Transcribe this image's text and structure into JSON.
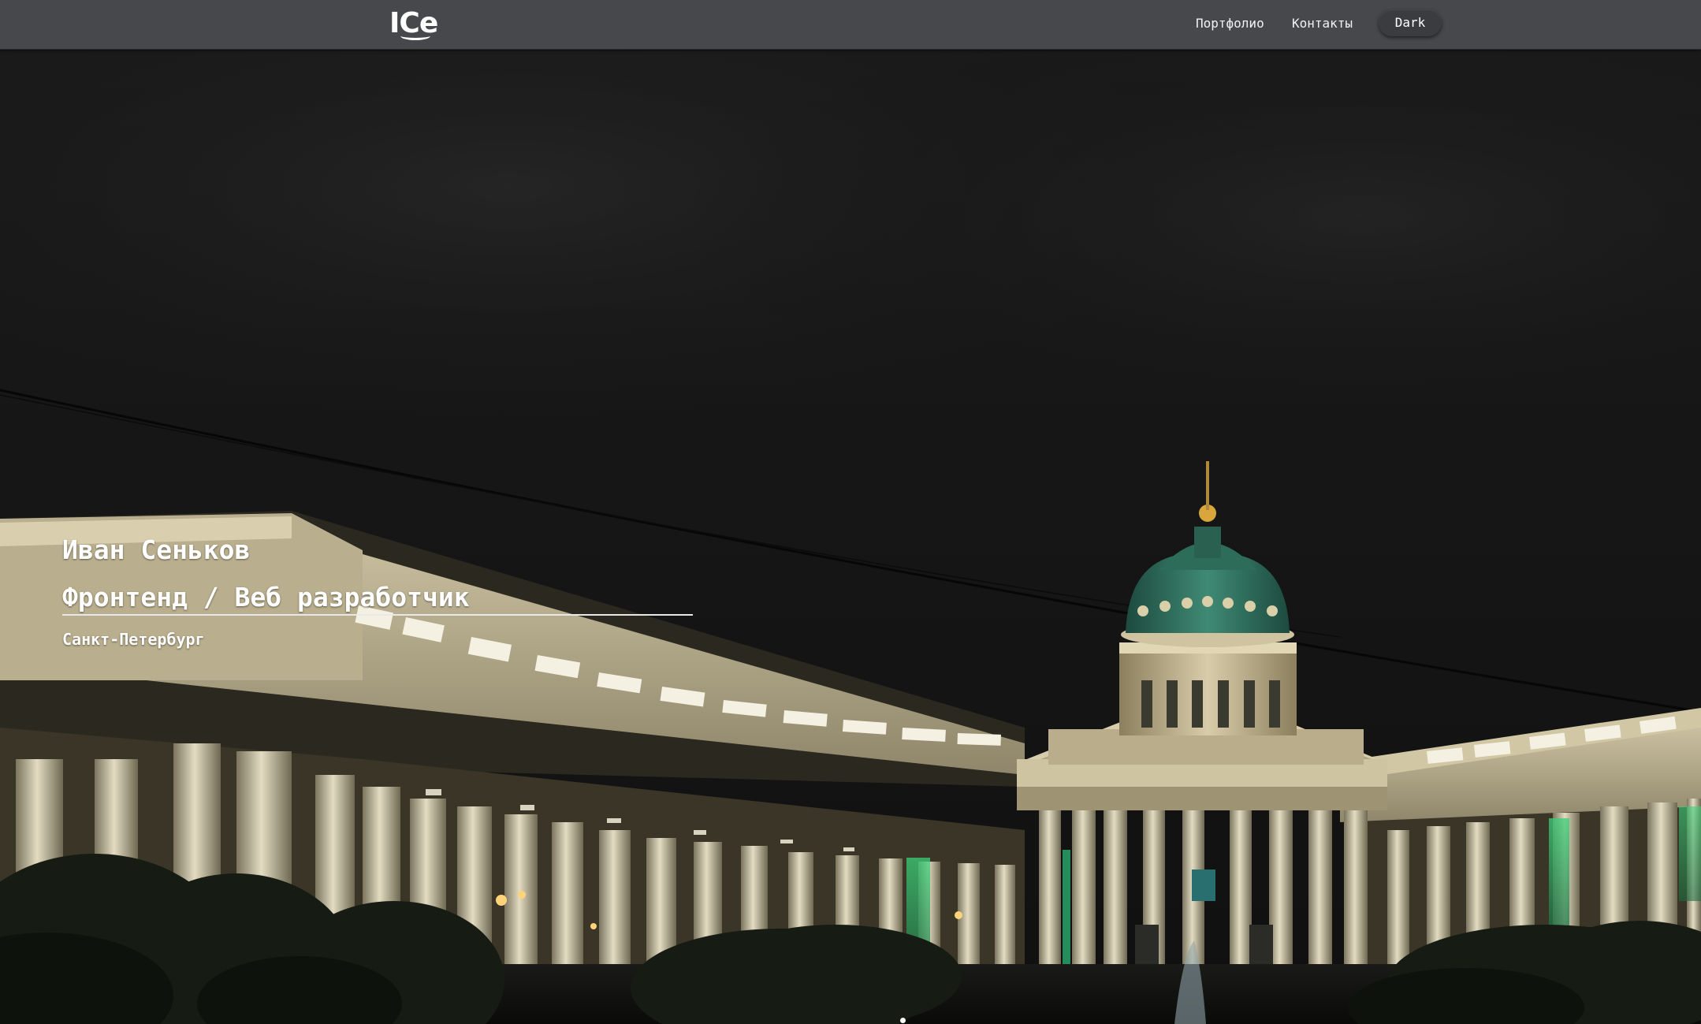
{
  "header": {
    "logo": "ICe",
    "nav": {
      "portfolio": "Портфолио",
      "contacts": "Контакты"
    },
    "theme_toggle": "Dark"
  },
  "hero": {
    "name": "Иван Сеньков",
    "role": "Фронтенд / Веб разработчик",
    "city": "Санкт-Петербург",
    "background": "night-photo-kazan-cathedral"
  },
  "colors": {
    "header_bg": "#47484c",
    "text": "#ffffff",
    "dome": "#2f6b5a",
    "sky": "#161616"
  }
}
